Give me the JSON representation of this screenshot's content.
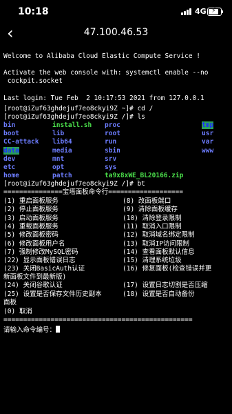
{
  "status_bar": {
    "time": "10:18",
    "network": "4G",
    "battery_level": 0.9,
    "battery_icon": "battery-charging-icon",
    "signal_icon": "signal-bars-icon"
  },
  "nav": {
    "back_icon": "chevron-left-icon",
    "title": "47.100.46.53"
  },
  "terminal": {
    "welcome": "Welcome to Alibaba Cloud Elastic Compute Service !",
    "activate": "Activate the web console with: systemctl enable --no",
    "activate_cont": " cockpit.socket",
    "last_login": "Last login: Tue Feb  2 10:17:53 2021 from 127.0.0.1",
    "prompt_cd": "[root@iZuf63ghdejuf7eo8ckyi9Z ~]# cd /",
    "prompt_ls": "[root@iZuf63ghdejuf7eo8ckyi9Z /]# ls",
    "ls_rows": [
      [
        {
          "text": "bin",
          "style": "blue"
        },
        {
          "text": "install.sh",
          "style": "green"
        },
        {
          "text": "proc",
          "style": "blue"
        },
        {
          "text": "tmp",
          "style": "hl"
        }
      ],
      [
        {
          "text": "boot",
          "style": "blue"
        },
        {
          "text": "lib",
          "style": "blue"
        },
        {
          "text": "root",
          "style": "blue"
        },
        {
          "text": "usr",
          "style": "blue"
        }
      ],
      [
        {
          "text": "CC-attack",
          "style": "blue"
        },
        {
          "text": "lib64",
          "style": "blue"
        },
        {
          "text": "run",
          "style": "blue"
        },
        {
          "text": "var",
          "style": "blue"
        }
      ],
      [
        {
          "text": "data",
          "style": "dhl"
        },
        {
          "text": "media",
          "style": "blue"
        },
        {
          "text": "sbin",
          "style": "blue"
        },
        {
          "text": "www",
          "style": "blue"
        }
      ],
      [
        {
          "text": "dev",
          "style": "blue"
        },
        {
          "text": "mnt",
          "style": "blue"
        },
        {
          "text": "srv",
          "style": "blue"
        },
        {
          "text": "",
          "style": "blue"
        }
      ],
      [
        {
          "text": "etc",
          "style": "blue"
        },
        {
          "text": "opt",
          "style": "blue"
        },
        {
          "text": "sys",
          "style": "blue"
        },
        {
          "text": "",
          "style": "blue"
        }
      ],
      [
        {
          "text": "home",
          "style": "blue"
        },
        {
          "text": "patch",
          "style": "blue"
        },
        {
          "text": "ta9x8xWE_BL20166.zip",
          "style": "green"
        },
        {
          "text": "",
          "style": "blue"
        }
      ]
    ],
    "prompt_bt": "[root@iZuf63ghdejuf7eo8ckyi9Z /]# bt",
    "menu_header": "===============宝塔面板命令行===================",
    "menu_rows": [
      [
        "(1) 重启面板服务",
        "(8) 改面板端口"
      ],
      [
        "(2) 停止面板服务",
        "(9) 清除面板缓存"
      ],
      [
        "(3) 启动面板服务",
        "(10) 清除登录限制"
      ],
      [
        "(4) 重载面板服务",
        "(11) 取消入口限制"
      ],
      [
        "(5) 修改面板密码",
        "(12) 取消域名绑定限制"
      ],
      [
        "(6) 修改面板用户名",
        "(13) 取消IP访问限制"
      ],
      [
        "(7) 强制修改MySQL密码",
        "(14) 查看面板默认信息"
      ],
      [
        "(22) 显示面板错误日志",
        "(15) 清理系统垃圾"
      ],
      [
        "(23) 关闭BasicAuth认证",
        "(16) 修复面板(检查错误并更"
      ]
    ],
    "menu_wrap1": "新面板文件到最新版)",
    "menu_row24": [
      "(24) 关闭谷歌认证",
      "(17) 设置日志切割是否压缩"
    ],
    "menu_row25": [
      "(25) 设置是否保存文件历史副本",
      "(18) 设置是否自动备份"
    ],
    "menu_wrap2": "面板",
    "menu_cancel": "(0) 取消",
    "menu_footer": "================================================",
    "input_prompt": "请输入命令编号："
  }
}
